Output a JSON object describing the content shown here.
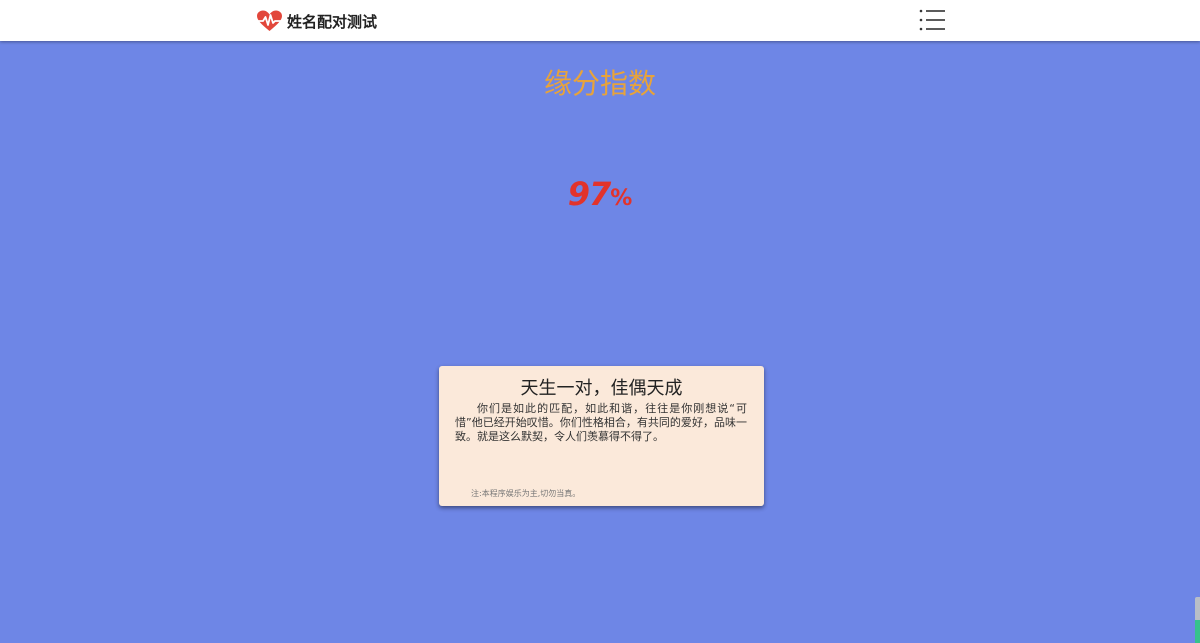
{
  "header": {
    "brand_name": "姓名配对测试",
    "brand_icon": "heart-pulse-icon",
    "menu_icon": "menu-icon"
  },
  "result": {
    "title": "缘分指数",
    "score_value": "97",
    "score_unit": "%"
  },
  "card": {
    "title": "天生一对，佳偶天成",
    "description": "你们是如此的匹配，如此和谐，往往是你刚想说“可惜”他已经开始叹惜。你们性格相合，有共同的爱好，品味一致。就是这么默契，令人们羡慕得不得了。",
    "note": "注:本程序娱乐为主,切勿当真。"
  },
  "colors": {
    "background": "#6e86e6",
    "title": "#e8a33a",
    "score": "#e2332b",
    "card_bg": "#fbe9da",
    "heart": "#e2473b"
  }
}
